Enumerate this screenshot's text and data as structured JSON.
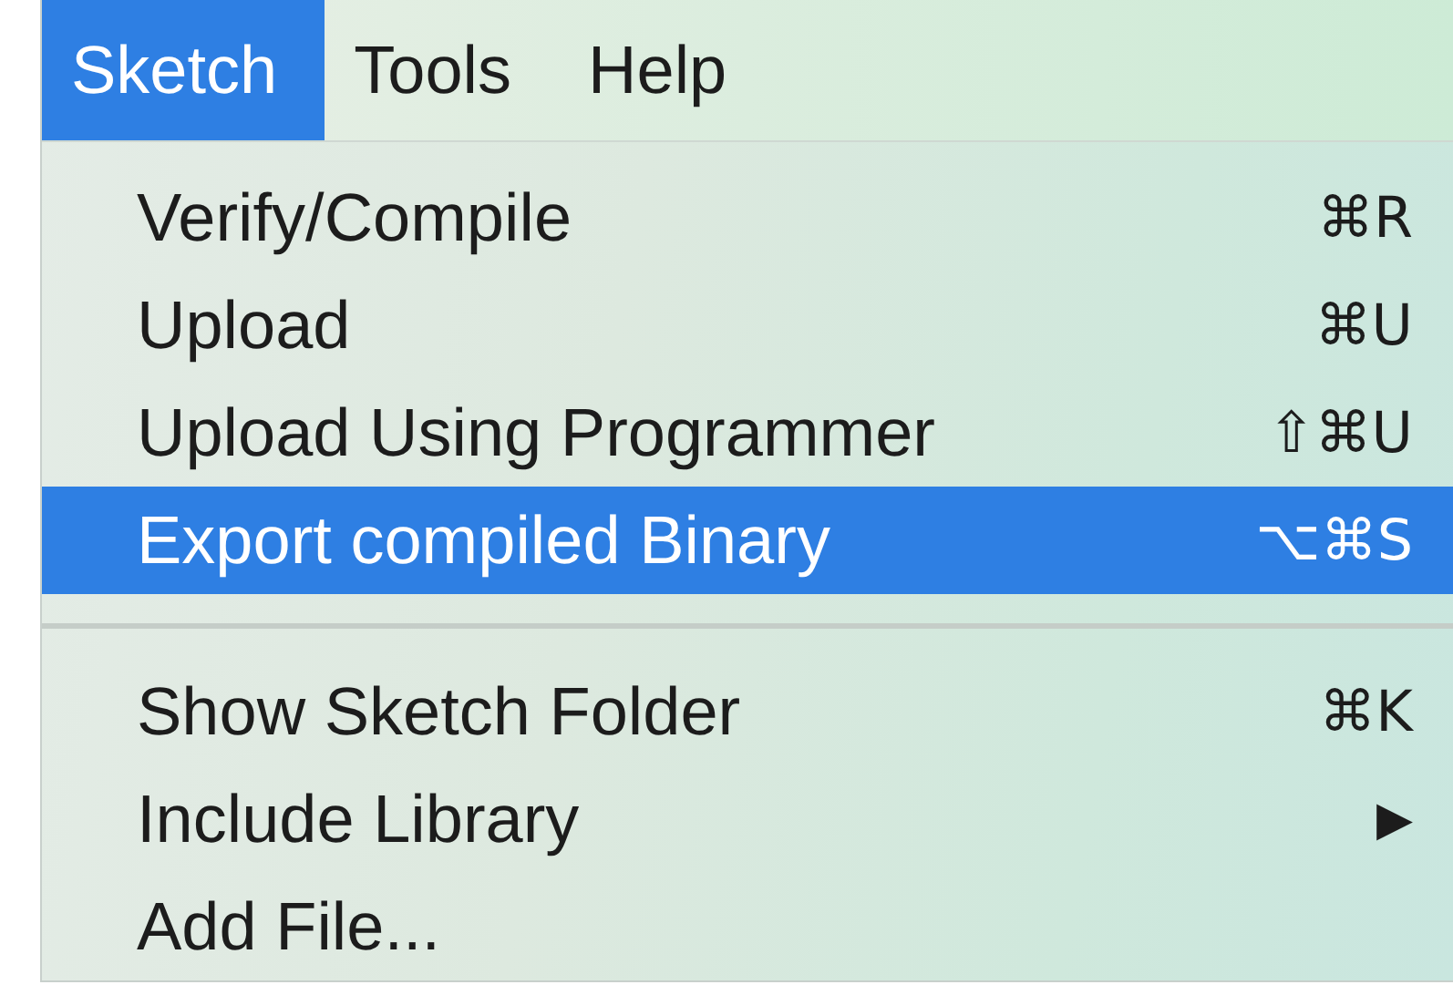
{
  "menubar": [
    {
      "label": "Sketch",
      "selected": true
    },
    {
      "label": "Tools",
      "selected": false
    },
    {
      "label": "Help",
      "selected": false
    }
  ],
  "menu": [
    {
      "kind": "item",
      "label": "Verify/Compile",
      "shortcut": "⌘R",
      "selected": false
    },
    {
      "kind": "item",
      "label": "Upload",
      "shortcut": "⌘U",
      "selected": false
    },
    {
      "kind": "item",
      "label": "Upload Using Programmer",
      "shortcut": "⇧⌘U",
      "selected": false
    },
    {
      "kind": "item",
      "label": "Export compiled Binary",
      "shortcut": "⌥⌘S",
      "selected": true
    },
    {
      "kind": "separator"
    },
    {
      "kind": "item",
      "label": "Show Sketch Folder",
      "shortcut": "⌘K",
      "selected": false
    },
    {
      "kind": "submenu",
      "label": "Include Library",
      "arrow": "▶",
      "selected": false
    },
    {
      "kind": "item",
      "label": "Add File...",
      "selected": false
    }
  ]
}
